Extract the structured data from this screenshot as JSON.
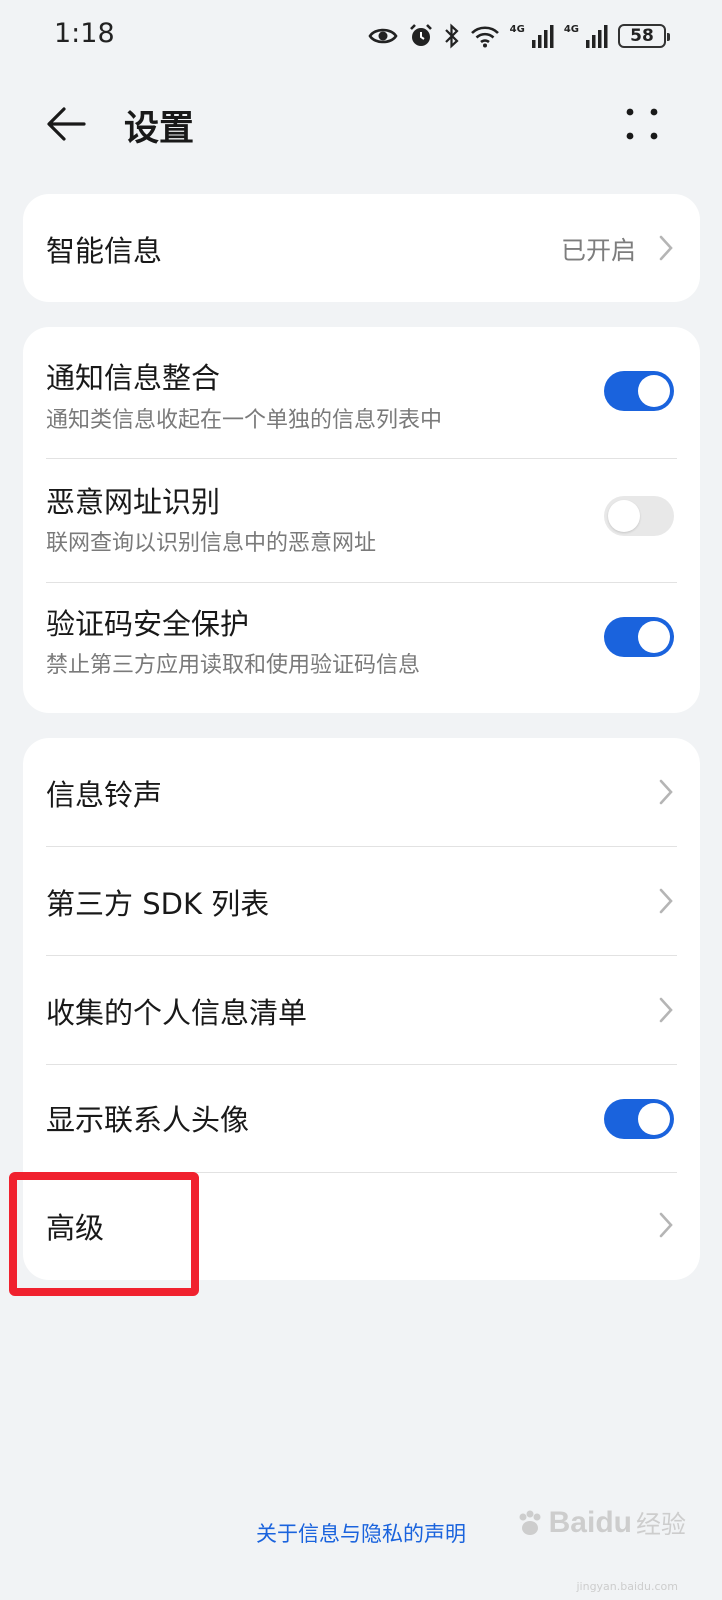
{
  "status_bar": {
    "time": "1:18",
    "net1": "4G",
    "net2": "4G",
    "battery": "58"
  },
  "header": {
    "title": "设置"
  },
  "smart_info": {
    "label": "智能信息",
    "value": "已开启"
  },
  "toggles": [
    {
      "title": "通知信息整合",
      "subtitle": "通知类信息收起在一个单独的信息列表中",
      "enabled": true
    },
    {
      "title": "恶意网址识别",
      "subtitle": "联网查询以识别信息中的恶意网址",
      "enabled": false
    },
    {
      "title": "验证码安全保护",
      "subtitle": "禁止第三方应用读取和使用验证码信息",
      "enabled": true
    }
  ],
  "menu": {
    "ringtone": "信息铃声",
    "sdk_list": "第三方 SDK 列表",
    "personal_info": "收集的个人信息清单",
    "show_avatar": {
      "label": "显示联系人头像",
      "enabled": true
    },
    "advanced": "高级"
  },
  "footer": {
    "privacy_link": "关于信息与隐私的声明"
  },
  "watermark": {
    "brand": "Baidu",
    "cn": "经验",
    "url": "jingyan.baidu.com"
  },
  "colors": {
    "accent": "#1a63dd",
    "highlight": "#f0212e",
    "background": "#f1f3f5"
  }
}
